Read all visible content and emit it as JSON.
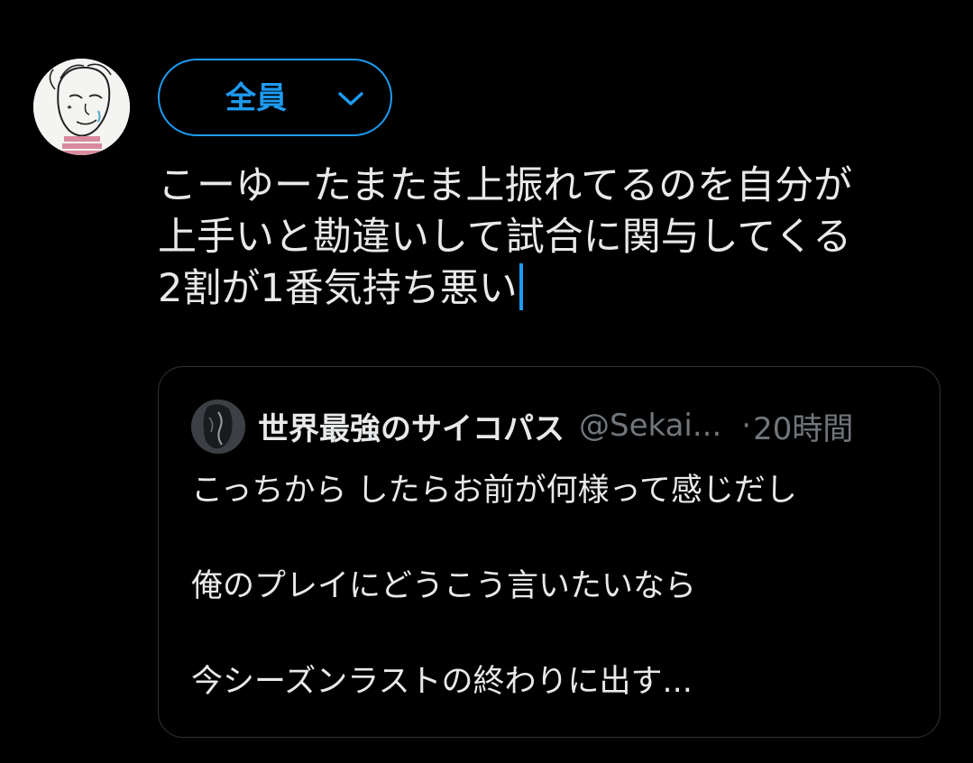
{
  "composer": {
    "avatar_alt": "user avatar",
    "audience_label": "全員",
    "chevron_icon": "chevron-down-icon",
    "text_lines": [
      "こーゆーたまたま上振れてるのを自分が",
      "上手いと勘違いして試合に関与してくる",
      "2割が1番気持ち悪い"
    ]
  },
  "quote": {
    "author_name": "世界最強のサイコパス",
    "author_handle": "@Sekai...",
    "separator": "·",
    "timestamp": "20時間",
    "body_lines": [
      "こっちから したらお前が何様って感じだし",
      "俺のプレイにどうこう言いたいなら",
      "今シーズンラストの終わりに出す..."
    ]
  },
  "colors": {
    "accent": "#1d9bf0",
    "background": "#000000",
    "text": "#e7e9ea",
    "muted": "#71767b",
    "border": "#2f3336"
  }
}
